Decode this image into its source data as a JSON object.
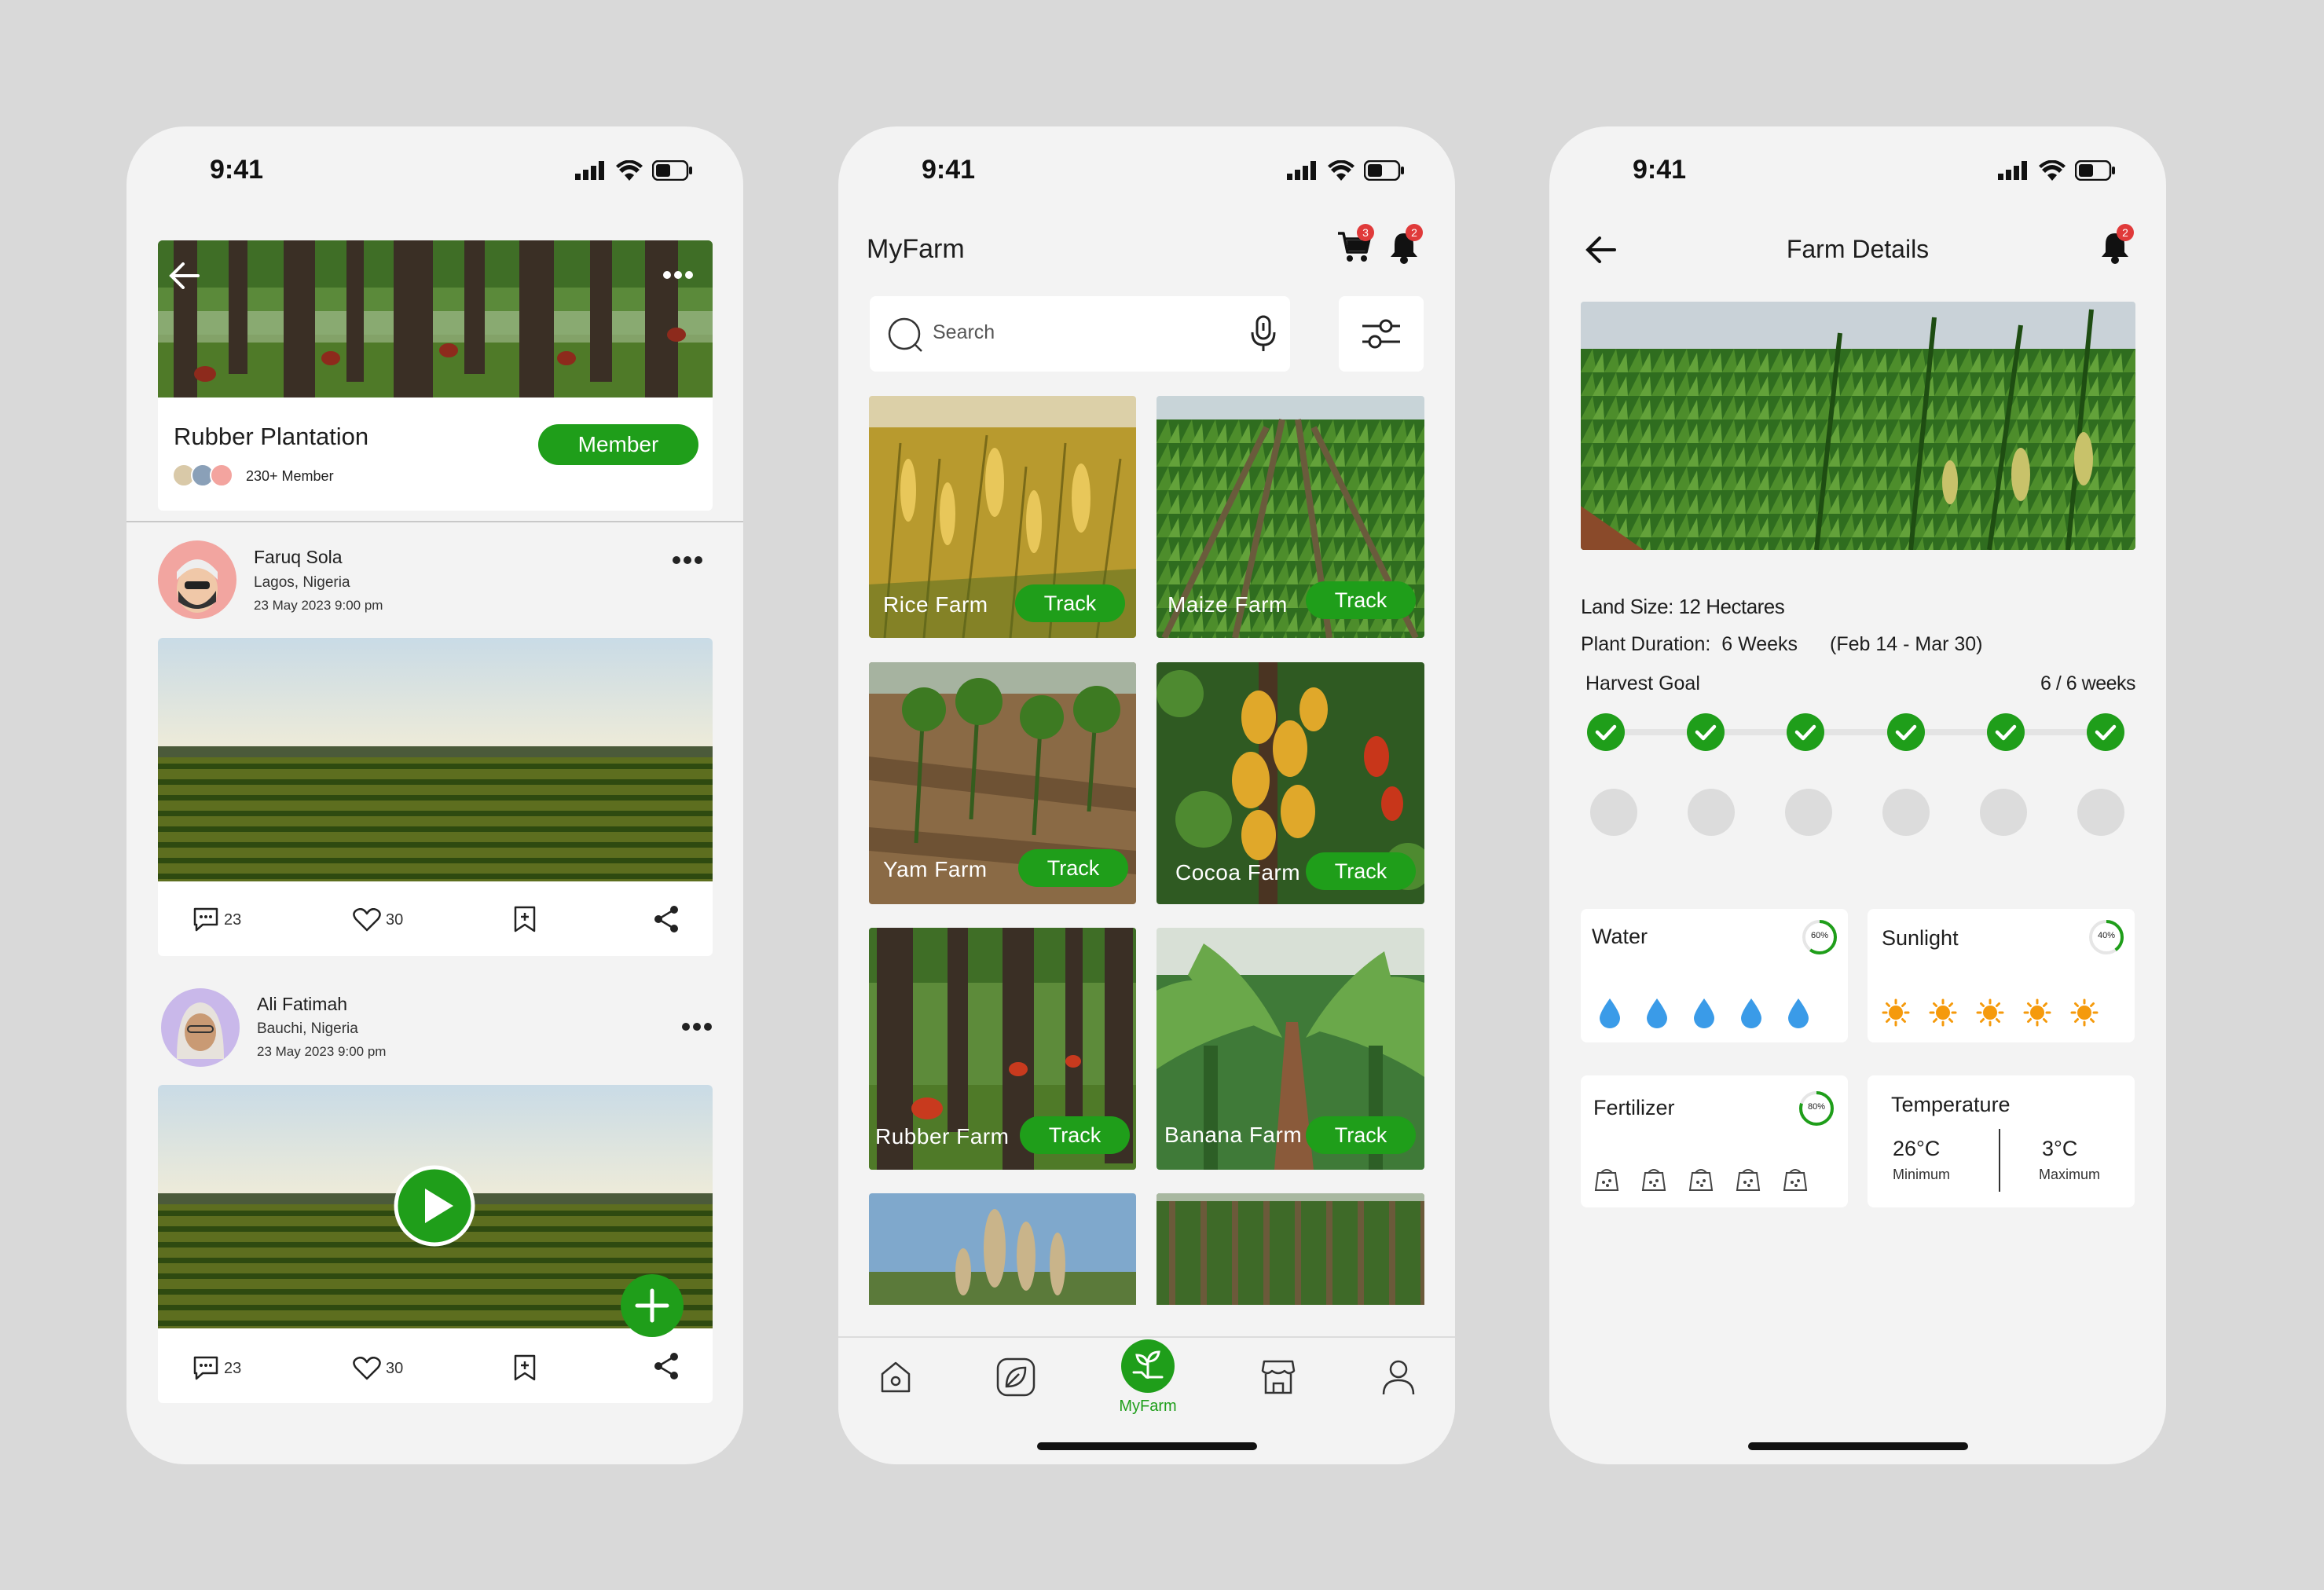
{
  "status": {
    "time": "9:41"
  },
  "community": {
    "group_name": "Rubber Plantation",
    "member_count": "230+ Member",
    "member_button": "Member",
    "posts": [
      {
        "author": "Faruq Sola",
        "location": "Lagos, Nigeria",
        "date": "23 May 2023 9:00 pm",
        "comments": "23",
        "likes": "30"
      },
      {
        "author": "Ali Fatimah",
        "location": "Bauchi, Nigeria",
        "date": "23 May 2023 9:00 pm",
        "comments": "23",
        "likes": "30"
      }
    ]
  },
  "myfarm": {
    "title": "MyFarm",
    "cart_badge": "3",
    "bell_badge": "2",
    "search_placeholder": "Search",
    "farms": [
      {
        "name": "Rice Farm",
        "action": "Track"
      },
      {
        "name": "Maize Farm",
        "action": "Track"
      },
      {
        "name": "Yam Farm",
        "action": "Track"
      },
      {
        "name": "Cocoa Farm",
        "action": "Track"
      },
      {
        "name": "Rubber Farm",
        "action": "Track"
      },
      {
        "name": "Banana Farm",
        "action": "Track"
      }
    ],
    "nav": {
      "active_label": "MyFarm"
    }
  },
  "details": {
    "title": "Farm Details",
    "bell_badge": "2",
    "land_size": "Land Size: 12 Hectares",
    "plant_duration": "Plant Duration:  6 Weeks",
    "date_range": "(Feb 14 - Mar 30)",
    "harvest_goal": "Harvest Goal",
    "harvest_progress": "6 / 6 weeks",
    "weeks_completed": 6,
    "water": {
      "label": "Water",
      "percent": "60%",
      "level": 0.6
    },
    "sunlight": {
      "label": "Sunlight",
      "percent": "40%",
      "level": 0.4
    },
    "fertilizer": {
      "label": "Fertilizer",
      "percent": "80%",
      "level": 0.8
    },
    "temperature": {
      "label": "Temperature",
      "min_value": "26°C",
      "min_label": "Minimum",
      "max_value": "3°C",
      "max_label": "Maximum"
    }
  },
  "colors": {
    "accent": "#1f9e1a",
    "badge": "#e03a3a",
    "water": "#3a9be8",
    "sun": "#f59a0c"
  }
}
